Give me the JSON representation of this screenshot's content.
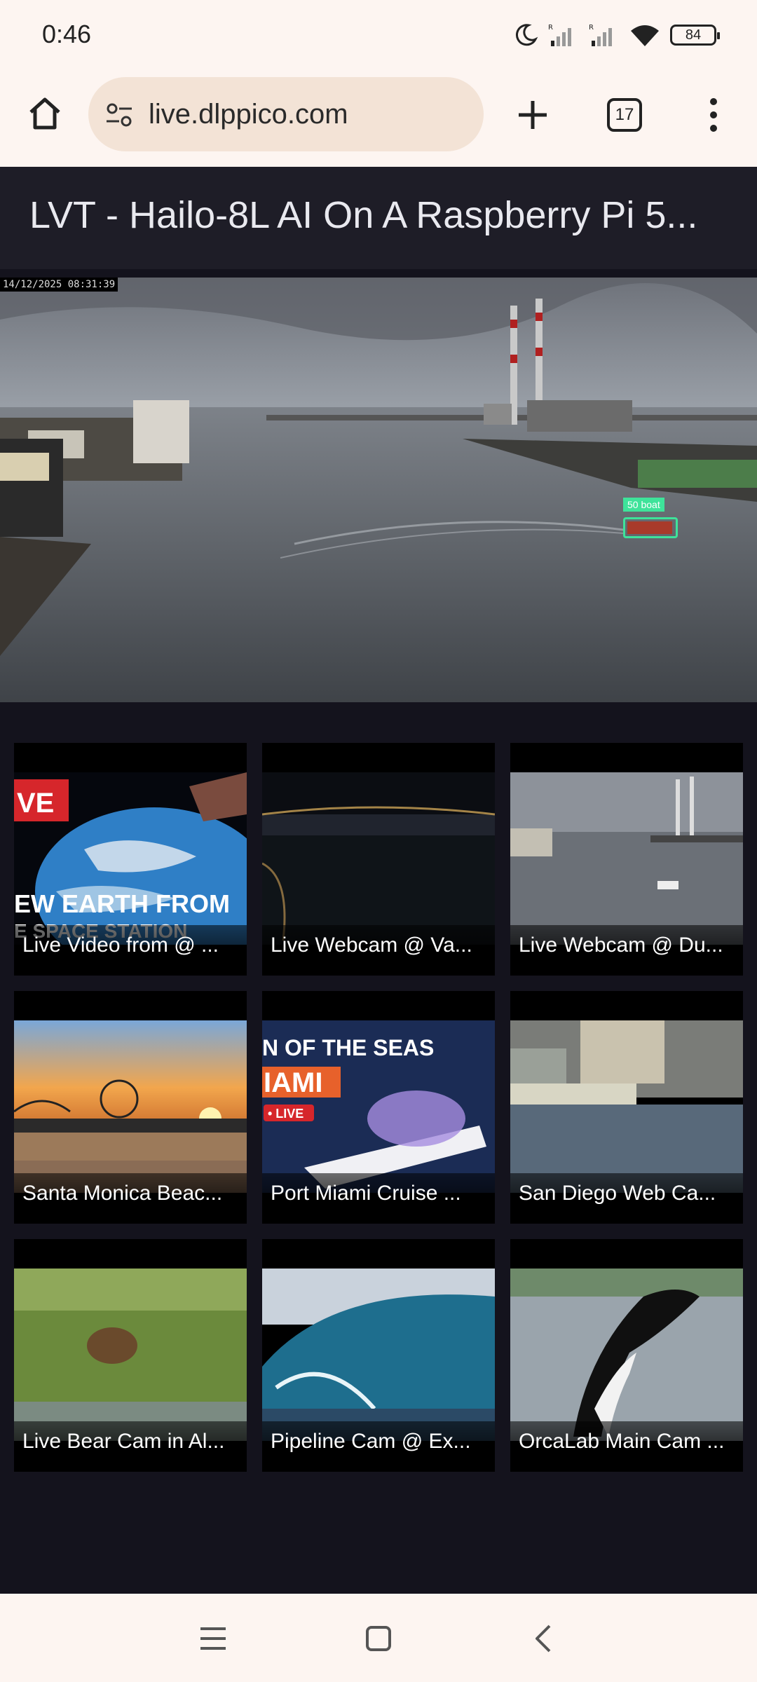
{
  "status_bar": {
    "time": "0:46",
    "battery": "84"
  },
  "browser": {
    "url": "live.dlppico.com",
    "tab_count": "17"
  },
  "page": {
    "title": "LVT - Hailo-8L AI On A Raspberry Pi 5..."
  },
  "main_video": {
    "timestamp": "14/12/2025 08:31:39",
    "detection_label": "50 boat"
  },
  "streams": [
    {
      "title": "Live Video from @ ..."
    },
    {
      "title": "Live Webcam @ Va..."
    },
    {
      "title": "Live Webcam @ Du..."
    },
    {
      "title": "Santa Monica Beac..."
    },
    {
      "title": "Port Miami Cruise ..."
    },
    {
      "title": "San Diego Web Ca..."
    },
    {
      "title": "Live Bear Cam in Al..."
    },
    {
      "title": "Pipeline Cam @ Ex..."
    },
    {
      "title": "OrcaLab Main Cam ..."
    }
  ],
  "thumb_text": {
    "live_badge": "VE",
    "earth_line1": "EW EARTH FROM",
    "earth_line2": "E SPACE STATION",
    "miami_seas": "N OF THE SEAS",
    "miami_city": "IAMI",
    "miami_live": "• LIVE"
  },
  "icons": {
    "home": "home-icon",
    "tune": "site-settings-icon",
    "new_tab": "plus-icon",
    "menu": "more-vert-icon",
    "recents": "recents-icon",
    "home_nav": "home-square-icon",
    "back": "back-icon"
  }
}
